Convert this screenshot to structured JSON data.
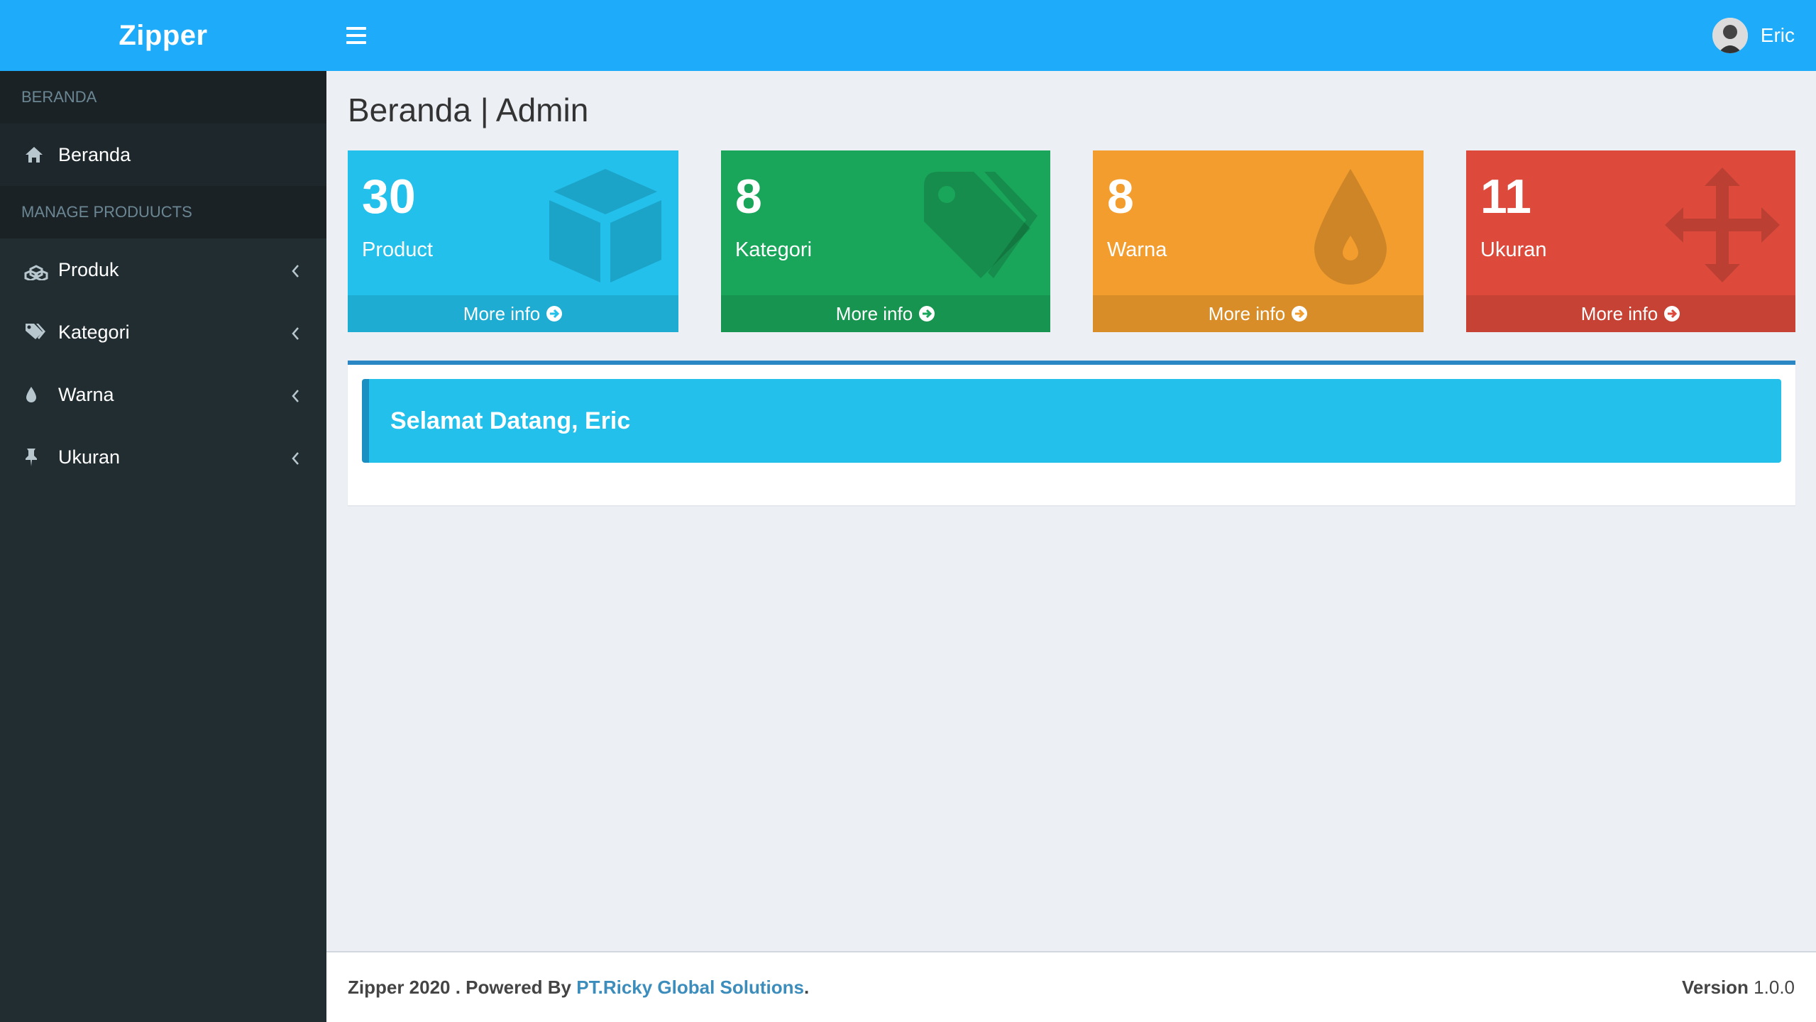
{
  "header": {
    "logo": "Zipper",
    "user_name": "Eric"
  },
  "sidebar": {
    "section1": "BERANDA",
    "beranda": "Beranda",
    "section2": "MANAGE PRODUUCTS",
    "items": [
      {
        "label": "Produk",
        "icon": "cubes-icon"
      },
      {
        "label": "Kategori",
        "icon": "tags-icon"
      },
      {
        "label": "Warna",
        "icon": "tint-icon"
      },
      {
        "label": "Ukuran",
        "icon": "thumb-tack-icon"
      }
    ]
  },
  "page": {
    "title": "Beranda | Admin"
  },
  "boxes": [
    {
      "value": "30",
      "label": "Product",
      "link": "More info",
      "color": "#22c0eb",
      "icon": "cube-icon"
    },
    {
      "value": "8",
      "label": "Kategori",
      "link": "More info",
      "color": "#1aa65a",
      "icon": "tags-icon"
    },
    {
      "value": "8",
      "label": "Warna",
      "link": "More info",
      "color": "#f29d2e",
      "icon": "tint-icon"
    },
    {
      "value": "11",
      "label": "Ukuran",
      "link": "More info",
      "color": "#dd4a3c",
      "icon": "arrows-icon"
    }
  ],
  "welcome": "Selamat Datang, Eric",
  "footer": {
    "prefix": "Zipper 2020 . Powered By",
    "company": "PT.Ricky Global Solutions",
    "suffix": ".",
    "version_label": "Version",
    "version_number": "1.0.0"
  },
  "colors": {
    "header": "#1eacfa",
    "sidebar": "#222d32",
    "accent_link": "#3c8dbc"
  }
}
